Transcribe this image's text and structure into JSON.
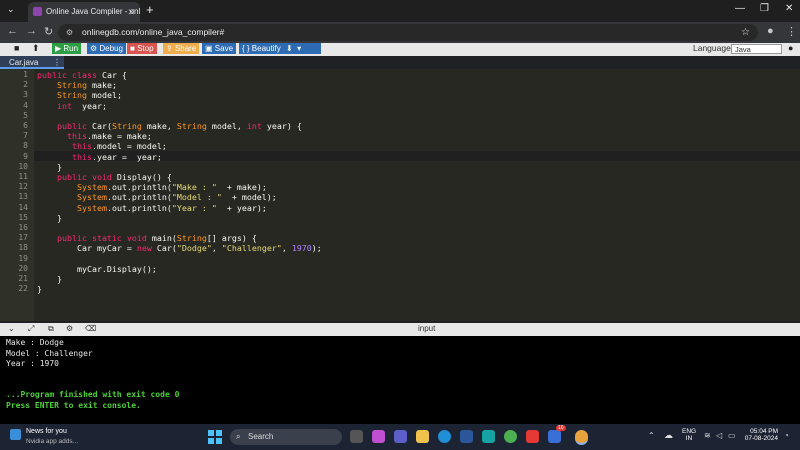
{
  "browser": {
    "tab_title": "Online Java Compiler - online e",
    "new_tab": "+",
    "url": "onlinegdb.com/online_java_compiler#"
  },
  "toolbar": {
    "buttons": [
      {
        "label": "Run",
        "color": "#2e9e44"
      },
      {
        "label": "Debug",
        "color": "#2d6bb5"
      },
      {
        "label": "Stop",
        "color": "#d9534f"
      },
      {
        "label": "Share",
        "color": "#f0ad4e"
      },
      {
        "label": "Save",
        "color": "#2d6bb5"
      },
      {
        "label": "{ } Beautify",
        "color": "#2d6bb5"
      }
    ],
    "language_label": "Language",
    "language_value": "Java"
  },
  "file_tab": "Car.java",
  "editor": {
    "line_numbers": [
      "1",
      "2",
      "3",
      "4",
      "5",
      "6",
      "7",
      "8",
      "9",
      "10",
      "11",
      "12",
      "13",
      "14",
      "15",
      "16",
      "17",
      "18",
      "19",
      "20",
      "21",
      "22"
    ]
  },
  "console": {
    "title": "input",
    "lines": [
      "Make : Dodge",
      "Model : Challenger",
      "Year : 1970"
    ],
    "finished": "...Program finished with exit code 0",
    "press_enter": "Press ENTER to exit console."
  },
  "taskbar": {
    "news_title": "News for you",
    "news_sub": "Nvidia app adds...",
    "search": "Search",
    "lang1": "ENG",
    "lang2": "IN",
    "time": "05:04 PM",
    "date": "07-08-2024",
    "badge": "16"
  }
}
